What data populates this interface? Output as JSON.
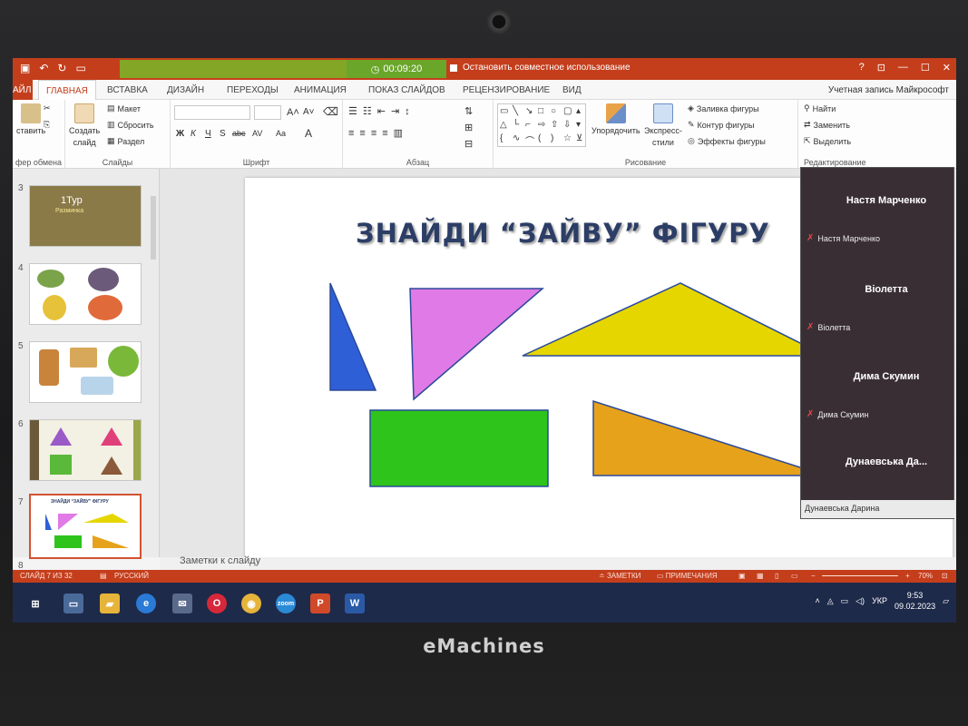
{
  "titlebar": {
    "timer": "00:09:20",
    "stop_sharing": "Остановить совместное использование",
    "help": "?",
    "controls": [
      "—",
      "☐",
      "✕"
    ]
  },
  "tabs": {
    "file": "АЙЛ",
    "items": [
      "ГЛАВНАЯ",
      "ВСТАВКА",
      "ДИЗАЙН",
      "ПЕРЕХОДЫ",
      "АНИМАЦИЯ",
      "ПОКАЗ СЛАЙДОВ",
      "РЕЦЕНЗИРОВАНИЕ",
      "ВИД"
    ],
    "account": "Учетная запись Майкрософт"
  },
  "ribbon": {
    "clipboard": {
      "paste": "ставить",
      "label": "фер обмена"
    },
    "slides": {
      "new_slide": "Создать",
      "new_slide2": "слайд",
      "layout": "Макет",
      "reset": "Сбросить",
      "section": "Раздел",
      "label": "Слайды"
    },
    "font": {
      "label": "Шрифт",
      "bold": "Ж",
      "italic": "К",
      "underline": "Ч",
      "strike": "S",
      "shadow": "abc",
      "spacing": "AV",
      "case": "Aa",
      "color": "A"
    },
    "paragraph": {
      "label": "Абзац"
    },
    "drawing": {
      "arrange": "Упорядочить",
      "quick_styles": "Экспресс-",
      "quick_styles2": "стили",
      "fill": "Заливка фигуры",
      "outline": "Контур фигуры",
      "effects": "Эффекты фигуры",
      "label": "Рисование"
    },
    "editing": {
      "find": "Найти",
      "replace": "Заменить",
      "select": "Выделить",
      "label": "Редактирование"
    }
  },
  "slide_panel": {
    "thumbs": [
      {
        "num": "3",
        "title": "1Тур",
        "subtitle": "Разминка"
      },
      {
        "num": "4"
      },
      {
        "num": "5"
      },
      {
        "num": "6"
      },
      {
        "num": "7",
        "title": "ЗНАЙДИ “ЗАЙВУ” ФІГУРУ"
      },
      {
        "num": "8"
      }
    ]
  },
  "slide": {
    "title": "ЗНАЙДИ “ЗАЙВУ” ФІГУРУ",
    "shape_colors": {
      "blue": "#2f5fd6",
      "pink": "#e07ae6",
      "yellow": "#e6d600",
      "green": "#2ec41c",
      "orange": "#e6a21a",
      "outline": "#2a4a9a"
    }
  },
  "participants": [
    {
      "name": "Настя Марченко",
      "label": "Настя Марченко"
    },
    {
      "name": "Віолетта",
      "label": "Віолетта"
    },
    {
      "name": "Дима Скумин",
      "label": "Дима Скумин"
    },
    {
      "name": "Дунаевська Да...",
      "label": "Дунаевська Дарина"
    }
  ],
  "notes": {
    "label": "Заметки к слайду"
  },
  "status": {
    "slide_info": "СЛАЙД 7 ИЗ 32",
    "language": "РУССКИЙ",
    "notes_btn": "ЗАМЕТКИ",
    "comments_btn": "ПРИМЕЧАНИЯ",
    "zoom": "70%"
  },
  "taskbar": {
    "lang": "УКР",
    "time": "9:53",
    "date": "09.02.2023"
  },
  "brand": "eMachines"
}
